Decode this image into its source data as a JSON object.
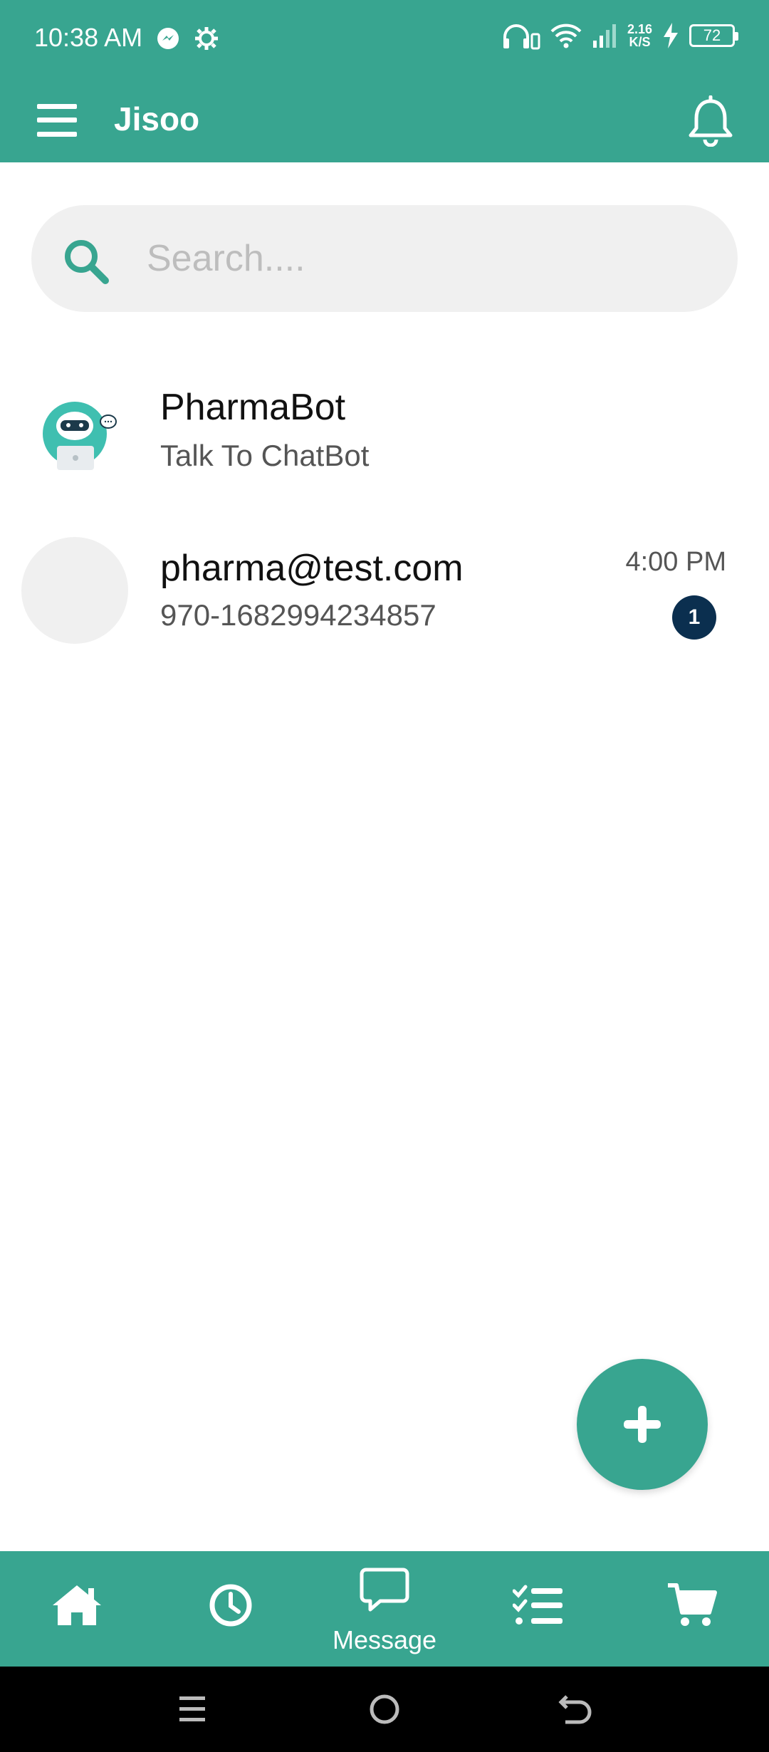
{
  "status_bar": {
    "time": "10:38 AM",
    "speed_value": "2.16",
    "speed_unit": "K/S",
    "battery": "72"
  },
  "app_bar": {
    "title": "Jisoo"
  },
  "search": {
    "placeholder": "Search...."
  },
  "chats": [
    {
      "name": "PharmaBot",
      "subtitle": "Talk To ChatBot",
      "avatar": "chatbot-robot"
    },
    {
      "name": "pharma@test.com",
      "subtitle": "970-1682994234857",
      "time": "4:00 PM",
      "unread": "1"
    }
  ],
  "bottom_nav": {
    "items": [
      {
        "icon": "home-icon"
      },
      {
        "icon": "history-icon"
      },
      {
        "icon": "message-icon",
        "label": "Message",
        "active": true
      },
      {
        "icon": "checklist-icon"
      },
      {
        "icon": "cart-icon"
      }
    ]
  },
  "colors": {
    "primary": "#38a590",
    "badge": "#0b2f4f",
    "search_bg": "#f0f0f0"
  }
}
